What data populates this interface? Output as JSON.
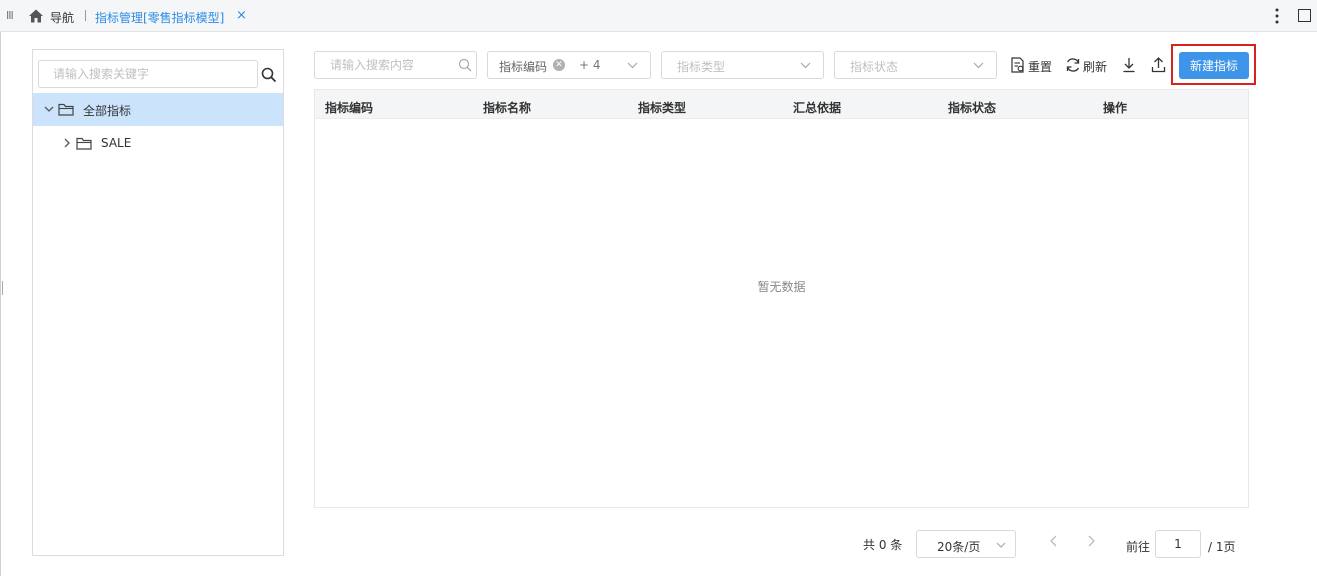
{
  "topbar": {
    "nav_label": "导航",
    "tab_label": "指标管理[零售指标模型]",
    "close_glyph": "×",
    "icons": [
      "menu-grip-icon",
      "home-icon",
      "close-icon",
      "more-vertical-icon",
      "maximize-icon"
    ]
  },
  "tree": {
    "search_placeholder": "请输入搜索关键字",
    "nodes": [
      {
        "label": "全部指标",
        "expanded": true,
        "selected": true
      },
      {
        "label": "SALE",
        "expanded": false,
        "selected": false
      }
    ]
  },
  "filters": {
    "search_placeholder": "请输入搜索内容",
    "code_tag": "指标编码",
    "code_more": "+ 4",
    "type_placeholder": "指标类型",
    "status_placeholder": "指标状态"
  },
  "toolbar": {
    "reset_label": "重置",
    "refresh_label": "刷新",
    "new_label": "新建指标"
  },
  "table": {
    "columns": [
      "指标编码",
      "指标名称",
      "指标类型",
      "汇总依据",
      "指标状态",
      "操作"
    ],
    "empty_text": "暂无数据"
  },
  "pagination": {
    "total": "共 0 条",
    "page_size": "20条/页",
    "goto_label": "前往",
    "current_page": "1",
    "pages": "/ 1页"
  },
  "colors": {
    "accent": "#3d94e8",
    "selected_row": "#cce4fb",
    "highlight": "#d9221d",
    "tab_text": "#2b8be6"
  }
}
